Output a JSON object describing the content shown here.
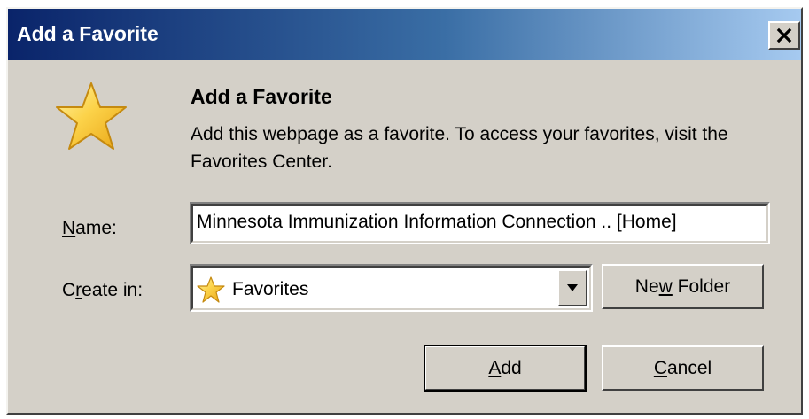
{
  "window": {
    "title": "Add a Favorite"
  },
  "icons": {
    "close": "close-icon",
    "favorite_star": "star-icon",
    "dropdown_arrow": "chevron-down-icon"
  },
  "dialog": {
    "heading": "Add a Favorite",
    "description": "Add this webpage as a favorite. To access your favorites, visit the Favorites Center."
  },
  "form": {
    "name_label_prefix": "N",
    "name_label_rest": "ame:",
    "name_value": "Minnesota Immunization Information Connection .. [Home]",
    "create_in_label_prefix": "C",
    "create_in_label_mnemonic": "r",
    "create_in_label_rest": "eate in:",
    "create_in_value": "Favorites"
  },
  "buttons": {
    "new_folder_prefix": "Ne",
    "new_folder_mnemonic": "w",
    "new_folder_rest": " Folder",
    "add_mnemonic": "A",
    "add_rest": "dd",
    "cancel_mnemonic": "C",
    "cancel_rest": "ancel"
  },
  "colors": {
    "titlebar_start": "#0a246a",
    "titlebar_end": "#a6caf0",
    "dialog_bg": "#d4d0c8",
    "star_fill": "#f7c325"
  }
}
